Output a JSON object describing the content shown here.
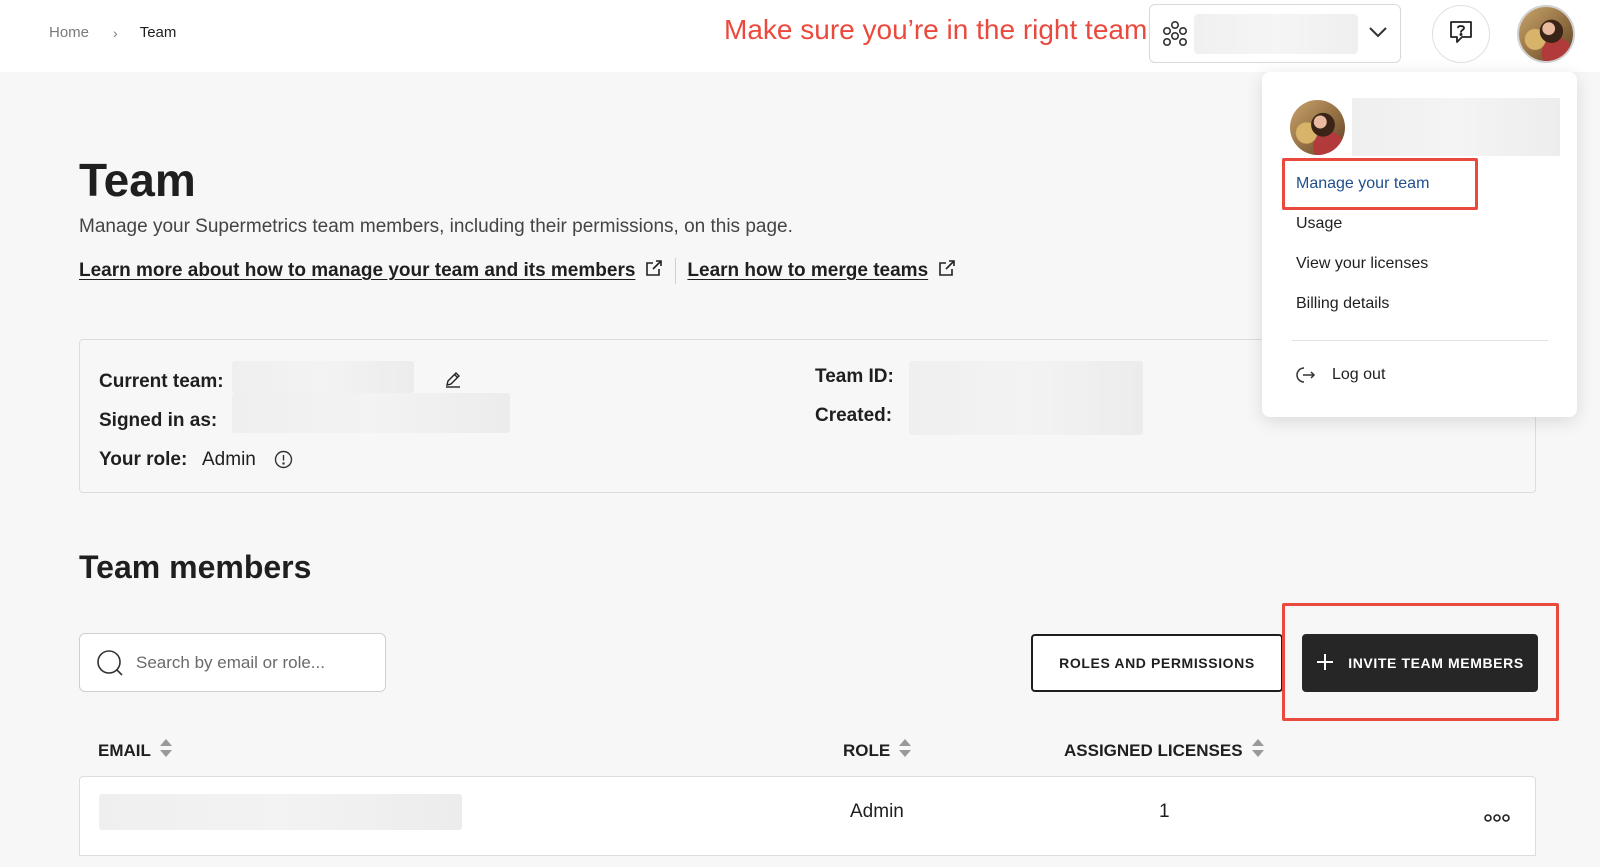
{
  "breadcrumb": {
    "home": "Home",
    "separator": "›",
    "current": "Team"
  },
  "annotation": {
    "text": "Make sure you’re in the right team",
    "color": "#ea4a3d"
  },
  "header": {
    "team_selector": {
      "team_name": "",
      "icon": "team-icon",
      "chevron": "chevron-down-icon"
    },
    "help_icon": "help-chat-icon",
    "avatar": "user-avatar"
  },
  "page": {
    "title": "Team",
    "description": "Manage your Supermetrics team members, including their permissions, on this page.",
    "link_manage": "Learn more about how to manage your team and its members",
    "link_merge": "Learn how to merge teams"
  },
  "info": {
    "current_team_label": "Current team:",
    "current_team_value": "",
    "signed_in_label": "Signed in as:",
    "signed_in_value": "",
    "role_label": "Your role:",
    "role_value": "Admin",
    "team_id_label": "Team ID:",
    "team_id_value": "",
    "created_label": "Created:",
    "created_value": ""
  },
  "members": {
    "section_title": "Team members",
    "search_placeholder": "Search by email or role...",
    "roles_button": "ROLES AND PERMISSIONS",
    "invite_button": "INVITE TEAM MEMBERS",
    "columns": {
      "email": "EMAIL",
      "role": "ROLE",
      "licenses": "ASSIGNED LICENSES"
    },
    "rows": [
      {
        "email": "",
        "role": "Admin",
        "licenses": "1"
      }
    ]
  },
  "dropdown": {
    "user_name": "",
    "items": [
      "Manage your team",
      "Usage",
      "View your licenses",
      "Billing details"
    ],
    "logout": "Log out"
  },
  "colors": {
    "accent_red": "#ea4a3d",
    "link_blue": "#1f4f8c",
    "dark_button": "#262626"
  }
}
